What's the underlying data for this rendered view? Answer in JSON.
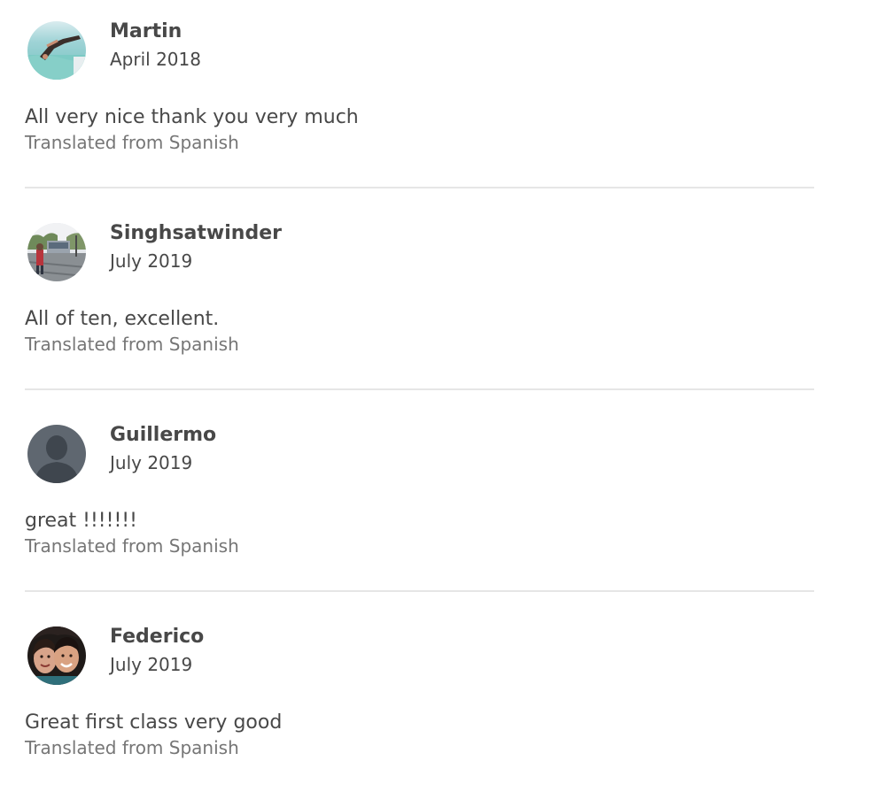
{
  "reviews": [
    {
      "name": "Martin",
      "date": "April 2018",
      "text": "All very nice thank you very much",
      "translation_note": "Translated from Spanish",
      "avatar": "diver-photo-avatar"
    },
    {
      "name": "Singhsatwinder",
      "date": "July 2019",
      "text": "All of ten, excellent.",
      "translation_note": "Translated from Spanish",
      "avatar": "street-tram-photo-avatar"
    },
    {
      "name": "Guillermo",
      "date": "July 2019",
      "text": "great !!!!!!!",
      "translation_note": "Translated from Spanish",
      "avatar": "default-user-silhouette-avatar"
    },
    {
      "name": "Federico",
      "date": "July 2019",
      "text": "Great first class very good",
      "translation_note": "Translated from Spanish",
      "avatar": "couple-selfie-photo-avatar"
    }
  ],
  "colors": {
    "text_primary": "#484848",
    "text_secondary": "#767676",
    "divider": "#e6e6e6",
    "default_avatar_bg": "#5f6770",
    "default_avatar_fg": "#3f464e"
  }
}
